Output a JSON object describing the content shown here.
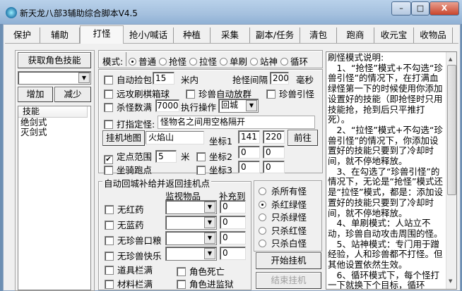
{
  "window": {
    "title": "新天龙八部3辅助综合脚本V4.5",
    "min": "–",
    "max": "□",
    "close": "X"
  },
  "tabs": [
    "保护",
    "辅助",
    "打怪",
    "抢小/喊话",
    "种植",
    "采集",
    "副本/任务",
    "清包",
    "跑商",
    "收元宝",
    "收物品"
  ],
  "skills": {
    "get_button": "获取角色技能",
    "combo_value": "",
    "add_button": "增加",
    "remove_button": "减少",
    "list_header": "技能",
    "items": [
      "绝剑式",
      "灭剑式"
    ]
  },
  "mode": {
    "label": "模式:",
    "options": [
      "普通",
      "抢怪",
      "拉怪",
      "单刷",
      "站神",
      "循环"
    ],
    "selected": 0
  },
  "options": {
    "auto_pickup": "自动捡包",
    "pickup_value": "15",
    "pickup_unit": "米内",
    "grab_interval": "抢怪间隔",
    "grab_interval_value": "200",
    "grab_interval_unit": "毫秒",
    "ranged_ball": "远攻刷棋箱球",
    "pet_auto_group": "珍兽自动放群",
    "pet_lure": "珍兽引怪",
    "kill_count": "杀怪数满",
    "kill_count_value": "7000",
    "exec_action": "执行操作",
    "action_value": "回城",
    "target_specific": "打指定怪",
    "target_placeholder": "怪物名之间用空格隔开",
    "map_button": "挂机地图",
    "map_value": "火焰山",
    "coord1": "坐标1",
    "coord1_x": "141",
    "coord1_y": "220",
    "goto_button": "前往",
    "fixed_range": "定点范围",
    "fixed_range_value": "5",
    "fixed_range_unit": "米",
    "fixed_range_checked": true,
    "coord2": "坐标2",
    "coord2_x": "0",
    "coord2_y": "0",
    "mount_run": "坐骑跑点",
    "coord3": "坐标3",
    "coord3_x": "0",
    "coord3_y": "0"
  },
  "resupply": {
    "title": "自动回城补给并返回挂机点",
    "col_item": "监视物品",
    "col_fill": "补充到",
    "rows": [
      {
        "label": "无红药",
        "value": "0"
      },
      {
        "label": "无蓝药",
        "value": "0"
      },
      {
        "label": "无珍兽口粮",
        "value": "0"
      },
      {
        "label": "无珍兽快乐",
        "value": "0"
      }
    ],
    "bag_full": "道具栏满",
    "char_dead": "角色死亡",
    "mat_full": "材料栏满",
    "char_jail": "角色进监狱"
  },
  "kill_filter": {
    "options": [
      "杀所有怪",
      "杀红绿怪",
      "只杀绿怪",
      "只杀红怪",
      "只杀白怪"
    ],
    "selected": 1
  },
  "actions": {
    "start": "开始挂机",
    "stop": "结束挂机"
  },
  "help": {
    "title": "刷怪模式说明:",
    "paragraphs": [
      "　1、“抢怪”模式+不勾选“珍兽引怪”的情况下，在打满血绿怪第一下的时候使用你添加设置好的技能（即抢怪时只用技能抢，抢到后只平推打死）。",
      "　2、“拉怪”模式+不勾选“珍兽引怪”的情况下，你添加设置好的技能只要到了冷却时间，就不停地释放。",
      "　3、在勾选了“珍兽引怪”的情况下，无论是“抢怪”模式还是“拉怪”模式，都是：添加设置好的技能只要到了冷却时间，就不停地释放。",
      "　4、单刷模式：人站立不动，珍兽自动攻击周围的怪。",
      "　5、站神模式：专门用于蹭经验，人和珍兽都不打怪。但其他设置依然生效。",
      "　6、循环模式下，每个怪打一下就换下个目标，循环"
    ]
  }
}
